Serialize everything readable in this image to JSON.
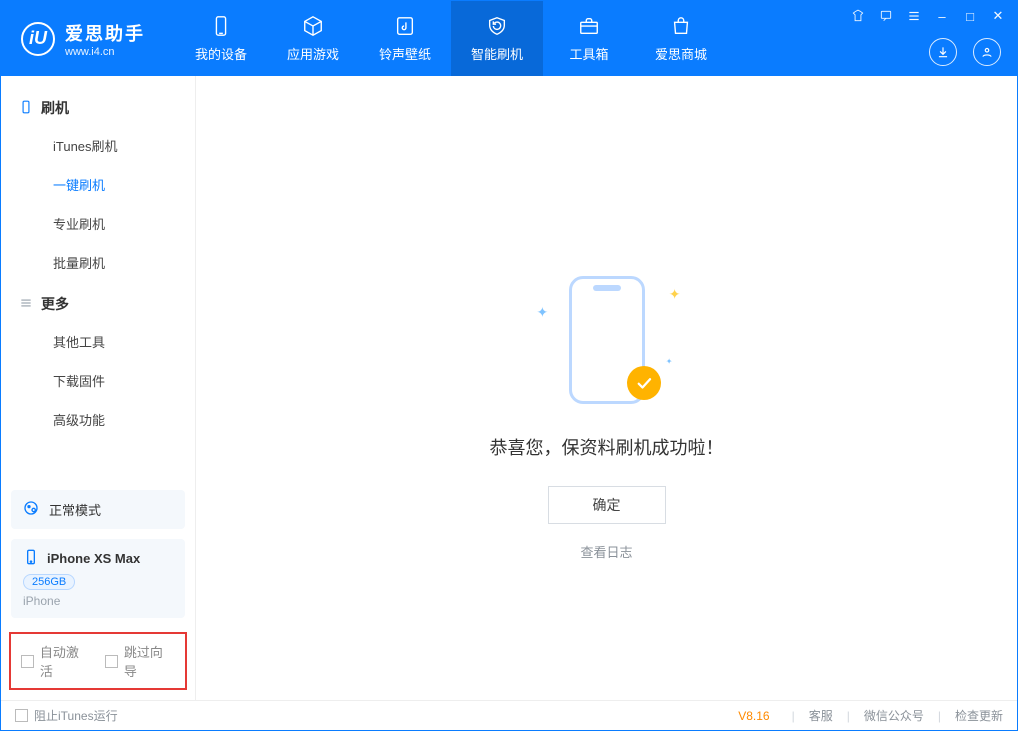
{
  "brand": {
    "name": "爱思助手",
    "site": "www.i4.cn",
    "logo_letter": "iU"
  },
  "topnav": {
    "items": [
      {
        "label": "我的设备"
      },
      {
        "label": "应用游戏"
      },
      {
        "label": "铃声壁纸"
      },
      {
        "label": "智能刷机"
      },
      {
        "label": "工具箱"
      },
      {
        "label": "爱思商城"
      }
    ],
    "active_index": 3
  },
  "window_controls": {
    "shirt": "◇",
    "feedback": "☐",
    "menu": "≡",
    "min": "–",
    "max": "□",
    "close": "✕"
  },
  "title_right_lower": {
    "download": "↓",
    "user": "◯"
  },
  "sidebar": {
    "groups": [
      {
        "title": "刷机",
        "icon": "phone-icon",
        "items": [
          {
            "label": "iTunes刷机"
          },
          {
            "label": "一键刷机",
            "active": true
          },
          {
            "label": "专业刷机"
          },
          {
            "label": "批量刷机"
          }
        ]
      },
      {
        "title": "更多",
        "icon": "more-icon",
        "items": [
          {
            "label": "其他工具"
          },
          {
            "label": "下载固件"
          },
          {
            "label": "高级功能"
          }
        ]
      }
    ],
    "mode_card": {
      "label": "正常模式"
    },
    "device_card": {
      "name": "iPhone XS Max",
      "capacity": "256GB",
      "platform": "iPhone"
    },
    "options": {
      "auto_activate": "自动激活",
      "skip_guide": "跳过向导"
    }
  },
  "main": {
    "success_text": "恭喜您，保资料刷机成功啦！",
    "ok_button": "确定",
    "log_link": "查看日志"
  },
  "statusbar": {
    "block_itunes": "阻止iTunes运行",
    "version": "V8.16",
    "links": [
      "客服",
      "微信公众号",
      "检查更新"
    ],
    "sep": "|"
  }
}
